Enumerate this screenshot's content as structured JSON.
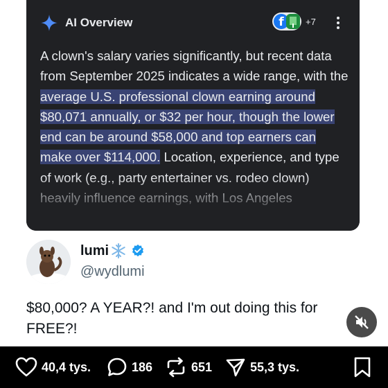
{
  "ai_overview": {
    "title": "AI Overview",
    "source_count": "+7",
    "text": {
      "plain_1": "A clown's salary varies significantly, but recent data from September 2025 indicates a wide range, with the ",
      "highlight": "average U.S. professional clown earning around $80,071 annually, or $32 per hour, though the lower end can be around $58,000 and top earners can make over $114,000.",
      "plain_2": " Location, experience, and type of work (e.g., party entertainer vs. rodeo clown) heavily influence earnings, with Los Angeles"
    },
    "colors": {
      "background": "#202124",
      "highlight": "#394373",
      "sparkle": "#4f8cf7"
    }
  },
  "tweet": {
    "display_name": "lumi",
    "name_emoji_icon": "snowflake-icon",
    "handle": "@wydlumi",
    "text": "$80,000? A YEAR?! and I'm out doing this for FREE?!",
    "verified_color": "#1d9bf0"
  },
  "actions": {
    "likes": "40,4 tys.",
    "replies": "186",
    "reposts": "651",
    "shares": "55,3 tys."
  }
}
